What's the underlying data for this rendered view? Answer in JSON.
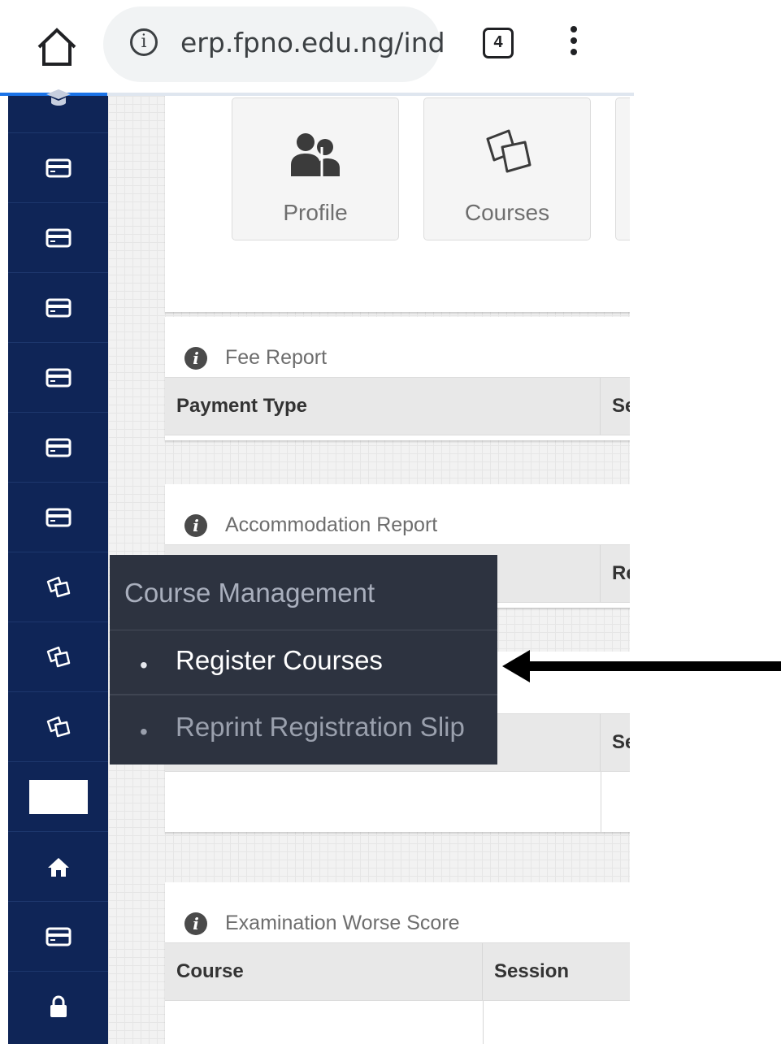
{
  "browser": {
    "url": "erp.fpno.edu.ng/ind",
    "tab_count": "4",
    "home_icon": "home-outline-icon",
    "info_icon": "info-icon",
    "menu_icon": "kebab-menu-icon"
  },
  "shortcuts": [
    {
      "label": "Profile",
      "icon": "users-icon"
    },
    {
      "label": "Courses",
      "icon": "book-pages-icon"
    }
  ],
  "fee_report": {
    "title": "Fee Report",
    "columns": [
      "Payment Type",
      "Se"
    ]
  },
  "accommodation_report": {
    "title": "Accommodation Report",
    "columns": [
      "Re"
    ]
  },
  "third_table": {
    "columns": [
      "Se"
    ]
  },
  "exam_report": {
    "title": "Examination Worse Score",
    "columns": [
      "Course",
      "Session"
    ]
  },
  "dropdown": {
    "title": "Course Management",
    "items": [
      {
        "label": "Register Courses",
        "bullet": "•"
      },
      {
        "label": "Reprint Registration Slip",
        "bullet": "•"
      }
    ]
  },
  "sidebar_icons": [
    "graduation-cap-icon",
    "credit-card-icon",
    "credit-card-icon",
    "credit-card-icon",
    "credit-card-icon",
    "credit-card-icon",
    "credit-card-icon",
    "book-pages-icon",
    "book-pages-icon",
    "book-pages-icon",
    "blank-box",
    "home-icon",
    "credit-card-icon",
    "lock-icon"
  ],
  "colors": {
    "sidebar": "#0f2557",
    "dropdown_bg": "#2d3340",
    "accent": "#1a73e8"
  }
}
